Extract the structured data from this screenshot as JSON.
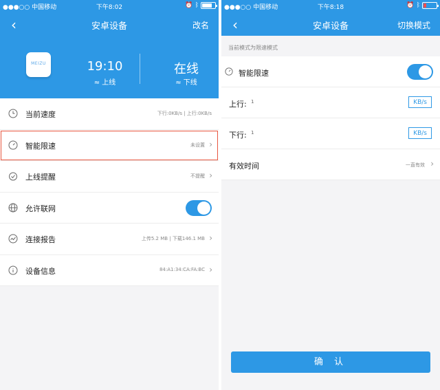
{
  "left": {
    "statusbar": {
      "carrier": "●●●○○ 中国移动",
      "time": "下午8:02"
    },
    "navbar": {
      "back": "‹",
      "title": "安卓设备",
      "action": "改名"
    },
    "device": {
      "logo": "MEIZU",
      "online_time": "19:10",
      "online_label": "≈ 上线",
      "status": "在线",
      "offline_label": "≈ 下线"
    },
    "rows": [
      {
        "label": "当前速度",
        "value": "下行:0KB/s | 上行:0KB/s"
      },
      {
        "label": "智能限速",
        "value": "未设置"
      },
      {
        "label": "上线提醒",
        "value": "不提醒"
      },
      {
        "label": "允许联网",
        "value": ""
      },
      {
        "label": "连接报告",
        "value": "上传5.2 MB | 下载146.1 MB"
      },
      {
        "label": "设备信息",
        "value": "84:A1:34:CA:FA:BC"
      }
    ]
  },
  "right": {
    "statusbar": {
      "carrier": "●●●○○ 中国移动",
      "time": "下午8:18"
    },
    "navbar": {
      "back": "‹",
      "title": "安卓设备",
      "action": "切换模式"
    },
    "mode_note": "当前模式为限速模式",
    "rows": [
      {
        "label": "智能限速"
      },
      {
        "label": "上行:",
        "sub": "1",
        "unit": "KB/s"
      },
      {
        "label": "下行:",
        "sub": "1",
        "unit": "KB/s"
      },
      {
        "label": "有效时间",
        "value": "一直有效"
      }
    ],
    "confirm": "确 认"
  },
  "colors": {
    "accent": "#2d98e5",
    "highlight": "#e8553e"
  }
}
